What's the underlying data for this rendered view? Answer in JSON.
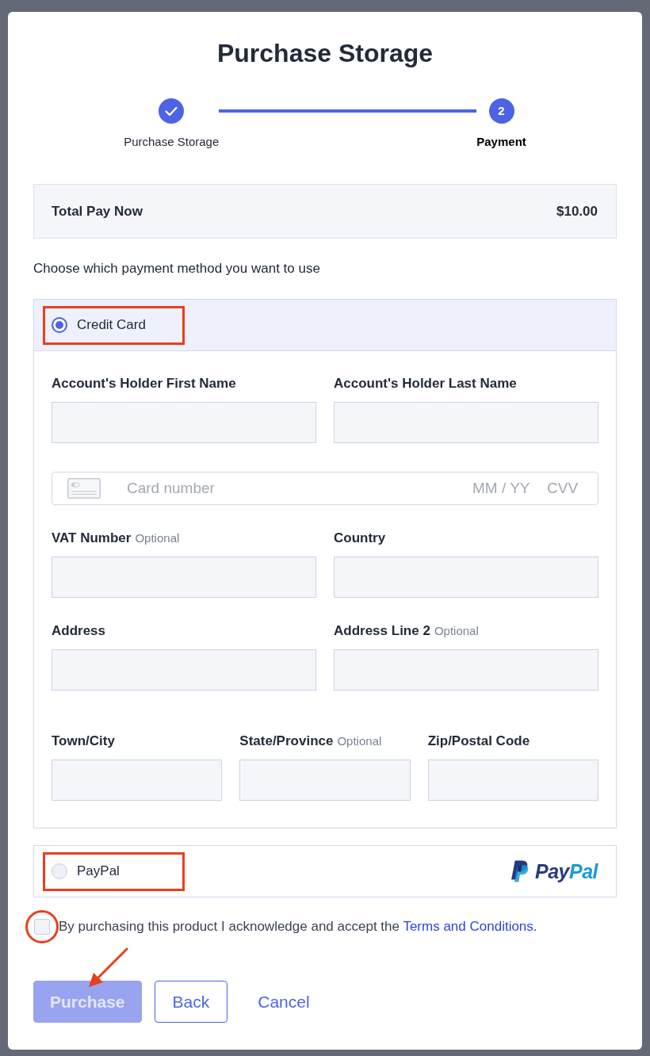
{
  "dialog": {
    "title": "Purchase Storage"
  },
  "steps": [
    {
      "label": "Purchase Storage",
      "completed": true,
      "selected": false
    },
    {
      "label": "Payment",
      "number": "2",
      "completed": false,
      "selected": true
    }
  ],
  "total": {
    "label": "Total Pay Now",
    "amount": "$10.00"
  },
  "prompt": "Choose which payment method you want to use",
  "payment_methods": [
    {
      "kind": "card",
      "label": "Credit Card",
      "selected": true,
      "highlighted": true,
      "form": {
        "rows": [
          {
            "kind": "fields",
            "fields": [
              {
                "label": "Account's Holder First Name"
              },
              {
                "label": "Account's Holder Last Name"
              }
            ]
          },
          {
            "kind": "card",
            "placeholder": "Card number",
            "expiry_placeholder": "MM / YY",
            "cvv_placeholder": "CVV"
          },
          {
            "kind": "fields",
            "fields": [
              {
                "label": "VAT Number",
                "hint": "Optional"
              },
              {
                "label": "Country"
              }
            ]
          },
          {
            "kind": "fields",
            "fields": [
              {
                "label": "Address"
              },
              {
                "label": "Address Line 2",
                "hint": "Optional"
              }
            ]
          },
          {
            "kind": "fields",
            "fields": [
              {
                "label": "Town/City"
              },
              {
                "label": "State/Province",
                "hint": "Optional"
              },
              {
                "label": "Zip/Postal Code"
              }
            ]
          }
        ]
      }
    },
    {
      "kind": "paypal",
      "label": "PayPal",
      "selected": false,
      "highlighted": true,
      "logo": [
        "Pay",
        "Pal"
      ]
    }
  ],
  "terms": {
    "checked": false,
    "highlighted": true,
    "text": "By purchasing this product I acknowledge and accept the",
    "link": "Terms and Conditions",
    "end": "."
  },
  "buttons": [
    {
      "kind": "primary",
      "label": "Purchase",
      "disabled": true,
      "highlighted": true
    },
    {
      "kind": "outline",
      "label": "Back",
      "disabled": false,
      "highlighted": false
    },
    {
      "kind": "link",
      "label": "Cancel",
      "disabled": false,
      "highlighted": false
    }
  ]
}
